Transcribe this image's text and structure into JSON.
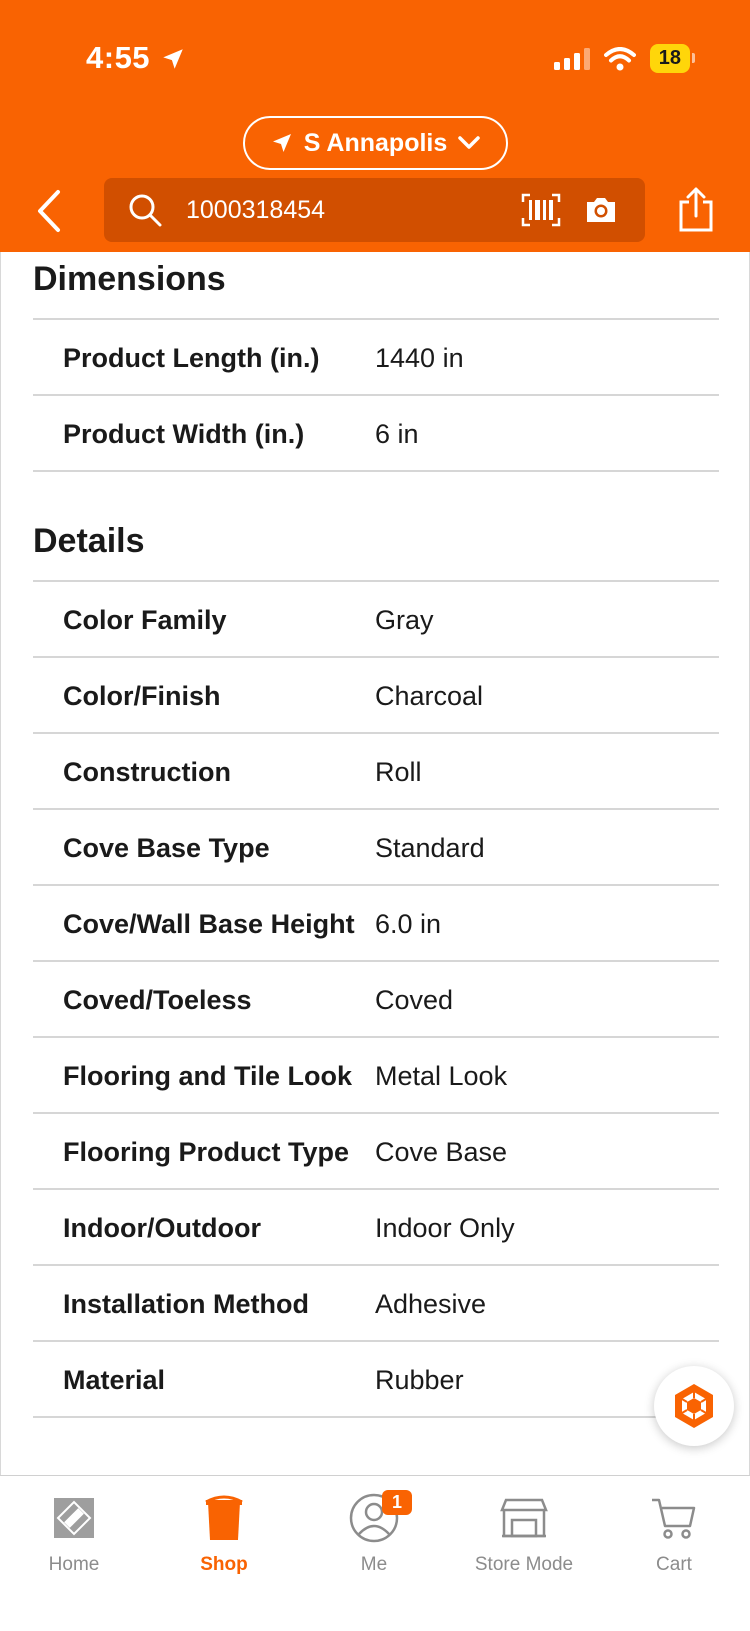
{
  "status_bar": {
    "time": "4:55",
    "battery": "18"
  },
  "header": {
    "store_name": "S Annapolis",
    "search_value": "1000318454"
  },
  "dimensions": {
    "title": "Dimensions",
    "rows": [
      {
        "label": "Product Length (in.)",
        "value": "1440 in"
      },
      {
        "label": "Product Width (in.)",
        "value": "6 in"
      }
    ]
  },
  "details": {
    "title": "Details",
    "rows": [
      {
        "label": "Color Family",
        "value": "Gray"
      },
      {
        "label": "Color/Finish",
        "value": "Charcoal"
      },
      {
        "label": "Construction",
        "value": "Roll"
      },
      {
        "label": "Cove Base Type",
        "value": "Standard"
      },
      {
        "label": "Cove/Wall Base Height",
        "value": "6.0 in"
      },
      {
        "label": "Coved/Toeless",
        "value": "Coved"
      },
      {
        "label": "Flooring and Tile Look",
        "value": "Metal Look"
      },
      {
        "label": "Flooring Product Type",
        "value": "Cove Base"
      },
      {
        "label": "Indoor/Outdoor",
        "value": "Indoor Only"
      },
      {
        "label": "Installation Method",
        "value": "Adhesive"
      },
      {
        "label": "Material",
        "value": "Rubber"
      }
    ]
  },
  "bottom_nav": {
    "items": [
      {
        "label": "Home",
        "icon": "home-depot-logo-icon"
      },
      {
        "label": "Shop",
        "icon": "bucket-icon",
        "active": true
      },
      {
        "label": "Me",
        "icon": "user-icon",
        "badge": "1"
      },
      {
        "label": "Store Mode",
        "icon": "store-icon"
      },
      {
        "label": "Cart",
        "icon": "cart-icon"
      }
    ]
  },
  "colors": {
    "brand": "#f96302",
    "search_bg": "#d14f00",
    "divider": "#d6d6d6"
  }
}
